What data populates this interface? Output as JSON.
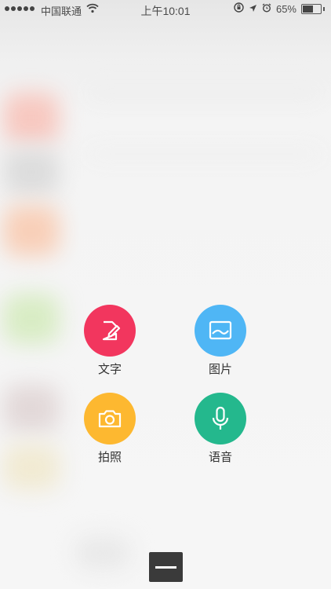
{
  "status_bar": {
    "carrier": "中国联通",
    "time": "上午10:01",
    "battery": "65%",
    "battery_level": 0.65,
    "signal_dots": 5,
    "icons": [
      "wifi-icon",
      "orientation-lock-icon",
      "location-arrow-icon",
      "alarm-icon",
      "battery-icon"
    ]
  },
  "actions": [
    {
      "label": "文字",
      "icon": "edit-note-icon",
      "color": "#f2365e"
    },
    {
      "label": "图片",
      "icon": "image-icon",
      "color": "#4fb6f5"
    },
    {
      "label": "拍照",
      "icon": "camera-icon",
      "color": "#fdb830"
    },
    {
      "label": "语音",
      "icon": "microphone-icon",
      "color": "#24b88d"
    }
  ],
  "close_button": {
    "icon": "close-minus-icon"
  }
}
